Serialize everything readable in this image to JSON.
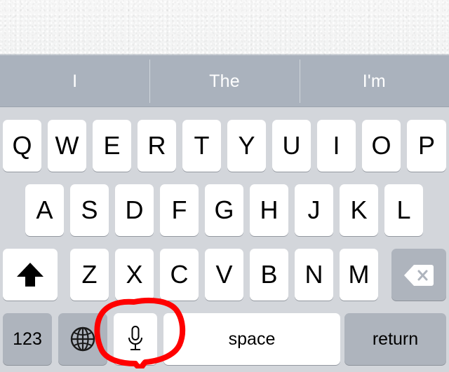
{
  "screen": {
    "platform": "ios-keyboard",
    "paper_background_color": "#f5f5f5",
    "keyboard_background_color": "#d3d6db",
    "suggestion_bar_color": "#aab2bd",
    "key_color": "#ffffff",
    "modifier_key_color": "#aeb4bd",
    "key_text_color": "#000000",
    "suggestion_text_color": "#ffffff",
    "annotation_color": "#ff0000"
  },
  "suggestion_bar": {
    "items": [
      {
        "label": "I"
      },
      {
        "label": "The"
      },
      {
        "label": "I'm"
      }
    ]
  },
  "keyboard": {
    "row1": [
      {
        "label": "Q"
      },
      {
        "label": "W"
      },
      {
        "label": "E"
      },
      {
        "label": "R"
      },
      {
        "label": "T"
      },
      {
        "label": "Y"
      },
      {
        "label": "U"
      },
      {
        "label": "I"
      },
      {
        "label": "O"
      },
      {
        "label": "P"
      }
    ],
    "row2": [
      {
        "label": "A"
      },
      {
        "label": "S"
      },
      {
        "label": "D"
      },
      {
        "label": "F"
      },
      {
        "label": "G"
      },
      {
        "label": "H"
      },
      {
        "label": "J"
      },
      {
        "label": "K"
      },
      {
        "label": "L"
      }
    ],
    "row3": {
      "shift": {
        "icon": "shift-arrow-icon",
        "label": ""
      },
      "letters": [
        {
          "label": "Z"
        },
        {
          "label": "X"
        },
        {
          "label": "C"
        },
        {
          "label": "V"
        },
        {
          "label": "B"
        },
        {
          "label": "N"
        },
        {
          "label": "M"
        }
      ],
      "backspace": {
        "icon": "backspace-delete-icon",
        "label": ""
      }
    },
    "row4": {
      "numeric": {
        "label": "123"
      },
      "globe": {
        "icon": "globe-icon",
        "label": ""
      },
      "dictation": {
        "icon": "microphone-icon",
        "label": ""
      },
      "space": {
        "label": "space"
      },
      "return": {
        "label": "return"
      }
    }
  },
  "annotation": {
    "target": "microphone-key",
    "shape": "hand-drawn-circle",
    "color": "#ff0000"
  }
}
